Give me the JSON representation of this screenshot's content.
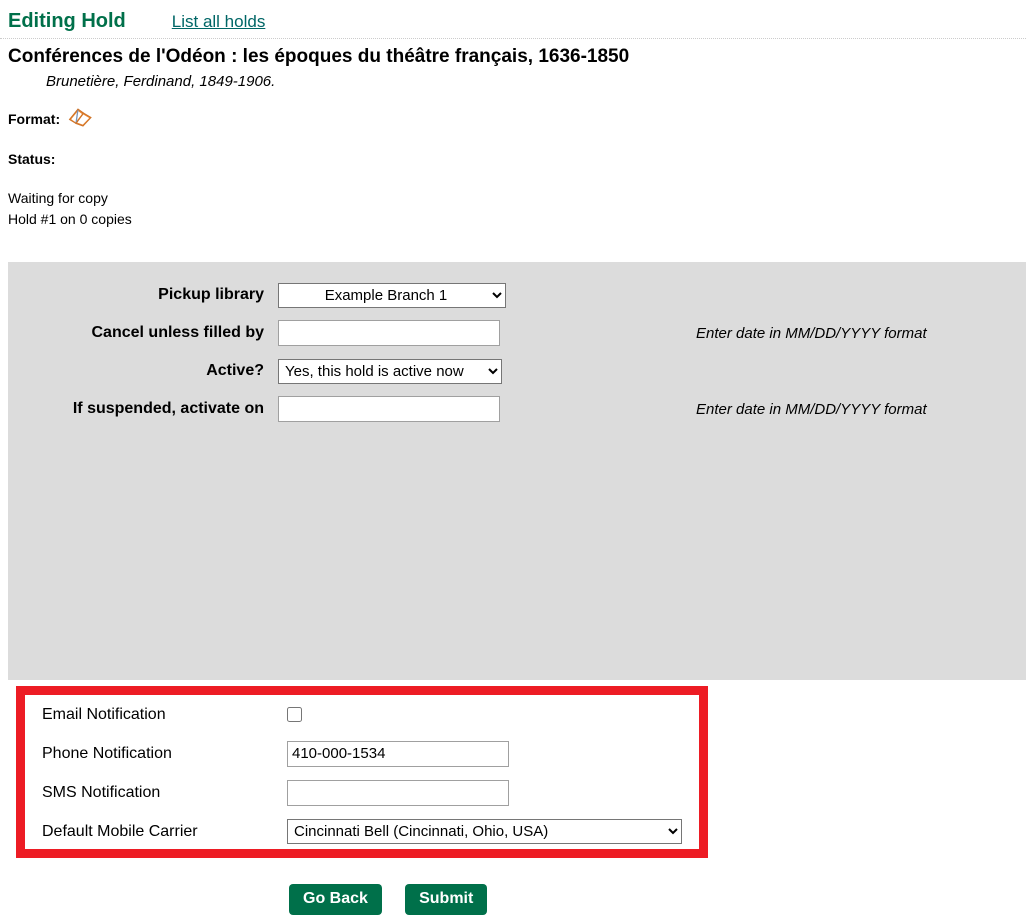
{
  "header": {
    "heading": "Editing Hold",
    "list_link": "List all holds"
  },
  "bib": {
    "title": "Conférences de l'Odéon : les époques du théâtre français, 1636-1850",
    "author": "Brunetière, Ferdinand, 1849-1906."
  },
  "meta": {
    "format_label": "Format:",
    "format_icon": "open-book-icon",
    "status_label": "Status:",
    "status_line_1": "Waiting for copy",
    "status_line_2": "Hold #1 on 0 copies"
  },
  "form": {
    "pickup_library": {
      "label": "Pickup library",
      "value": "Example Branch 1",
      "options": [
        "Example Branch 1"
      ]
    },
    "cancel_unless_filled_by": {
      "label": "Cancel unless filled by",
      "value": "",
      "placeholder": "",
      "hint": "Enter date in MM/DD/YYYY format"
    },
    "active": {
      "label": "Active?",
      "value": "Yes, this hold is active now",
      "options": [
        "Yes, this hold is active now"
      ]
    },
    "if_suspended_activate_on": {
      "label": "If suspended, activate on",
      "value": "",
      "placeholder": "",
      "hint": "Enter date in MM/DD/YYYY format"
    }
  },
  "notifications": {
    "email": {
      "label": "Email Notification",
      "checked": false
    },
    "phone": {
      "label": "Phone Notification",
      "value": "410-000-1534",
      "placeholder": ""
    },
    "sms": {
      "label": "SMS Notification",
      "value": "",
      "placeholder": ""
    },
    "carrier": {
      "label": "Default Mobile Carrier",
      "value": "Cincinnati Bell (Cincinnati, Ohio, USA)",
      "options": [
        "Cincinnati Bell (Cincinnati, Ohio, USA)"
      ]
    }
  },
  "buttons": {
    "go_back": "Go Back",
    "submit": "Submit"
  },
  "colors": {
    "accent_green": "#00704a",
    "link_green": "#006666",
    "highlight_red": "#ed1c24",
    "panel_gray": "#dcdcdc"
  }
}
